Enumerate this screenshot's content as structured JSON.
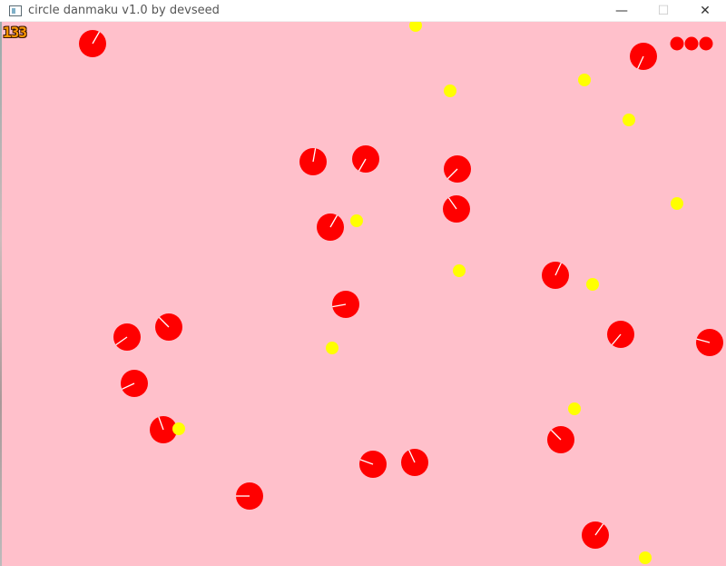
{
  "window": {
    "title": "circle danmaku v1.0 by devseed",
    "controls": {
      "minimize": "—",
      "maximize": "☐",
      "close": "✕"
    }
  },
  "hud": {
    "score": "133",
    "lives": 3
  },
  "colors": {
    "background": "#ffc0cb",
    "enemy": "#ff0000",
    "bullet": "#ffff00",
    "score": "#ff9900"
  },
  "icons": [
    "app-icon",
    "minimize-icon",
    "maximize-icon",
    "close-icon",
    "life-icon"
  ]
}
